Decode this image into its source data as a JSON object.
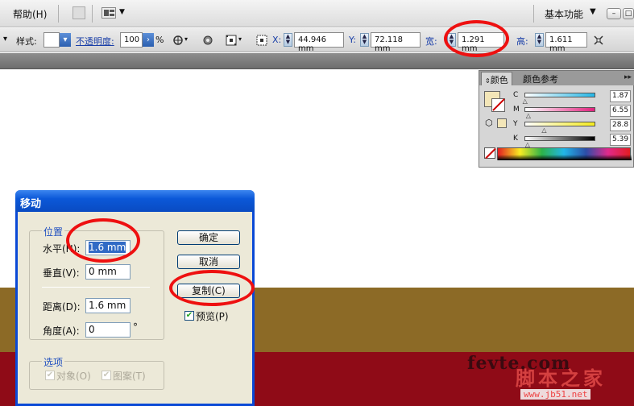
{
  "menubar": {
    "help": "帮助(H)",
    "workspace": "基本功能"
  },
  "controlbar": {
    "style_label": "样式:",
    "opacity_label": "不透明度:",
    "opacity_value": "100",
    "opacity_unit": "%",
    "x_label": "X:",
    "x_value": "44.946 mm",
    "y_label": "Y:",
    "y_value": "72.118 mm",
    "w_label": "宽:",
    "w_value": "1.291 mm",
    "h_label": "高:",
    "h_value": "1.611 mm"
  },
  "color_panel": {
    "tabs": [
      "颜色",
      "颜色参考"
    ],
    "channels": [
      {
        "name": "C",
        "value": "1.87",
        "level": 0.0187,
        "gradient": "#25b6e6"
      },
      {
        "name": "M",
        "value": "6.55",
        "level": 0.0655,
        "gradient": "#e0227e"
      },
      {
        "name": "Y",
        "value": "28.8",
        "level": 0.288,
        "gradient": "#f4ea1e"
      },
      {
        "name": "K",
        "value": "5.39",
        "level": 0.0539,
        "gradient": "#000000"
      }
    ],
    "fill_color": "#f3e6b8"
  },
  "dialog": {
    "title": "移动",
    "position_group": "位置",
    "horizontal_label": "水平(H):",
    "horizontal_value": "1.6 mm",
    "vertical_label": "垂直(V):",
    "vertical_value": "0 mm",
    "distance_label": "距离(D):",
    "distance_value": "1.6 mm",
    "angle_label": "角度(A):",
    "angle_value": "0",
    "angle_unit": "°",
    "options_group": "选项",
    "objects_label": "对象(O)",
    "pattern_label": "图案(T)",
    "ok_button": "确定",
    "cancel_button": "取消",
    "copy_button": "复制(C)",
    "preview_label": "预览(P)"
  },
  "watermark": {
    "line1": "fevte.com",
    "line2": "脚本之家",
    "line3": "www.jb51.net"
  }
}
